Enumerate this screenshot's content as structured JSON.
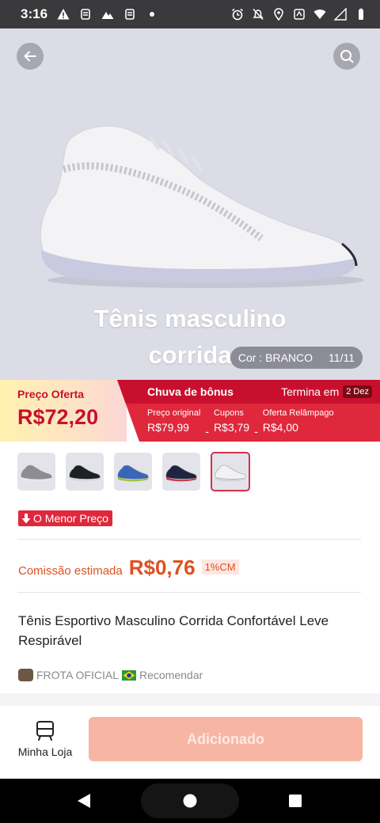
{
  "status_bar": {
    "time": "3:16"
  },
  "hero": {
    "title": "Tênis masculino corrida",
    "color_label": "Cor : BRANCO",
    "image_counter": "11/11"
  },
  "price": {
    "offer_label": "Preço Oferta",
    "offer_price": "R$72,20",
    "bonus_title": "Chuva de bônus",
    "ends_label": "Termina em",
    "ends_date": "2 Dez",
    "breakdown": [
      {
        "label": "Preço original",
        "value": "R$79,99"
      },
      {
        "label": "Cupons",
        "value": "R$3,79"
      },
      {
        "label": "Oferta Relâmpago",
        "value": "R$4,00"
      }
    ],
    "operator": "-"
  },
  "thumbnails": [
    {
      "color": "#8c8c92",
      "sole": "#e8e8ec"
    },
    {
      "color": "#1e2024",
      "sole": "#d8d8dc"
    },
    {
      "color": "#3a66b8",
      "sole": "#9cc43a"
    },
    {
      "color": "#1f2540",
      "sole": "#c83a4a"
    },
    {
      "color": "#f2f2f4",
      "sole": "#d0d0d8"
    }
  ],
  "badge": {
    "lowest_price": "O Menor Preço"
  },
  "commission": {
    "label": "Comissão estimada",
    "value": "R$0,76",
    "rate": "1%CM"
  },
  "product": {
    "title": "Tênis Esportivo Masculino Corrida Confortável Leve Respirável"
  },
  "seller": {
    "name": "FROTA OFICIAL",
    "recommend": "Recomendar"
  },
  "bottom": {
    "my_store": "Minha Loja",
    "add_button": "Adicionado"
  },
  "colors": {
    "accent_red": "#e0283c",
    "commission_orange": "#e0501f",
    "disabled_button": "#f7b6a3"
  }
}
